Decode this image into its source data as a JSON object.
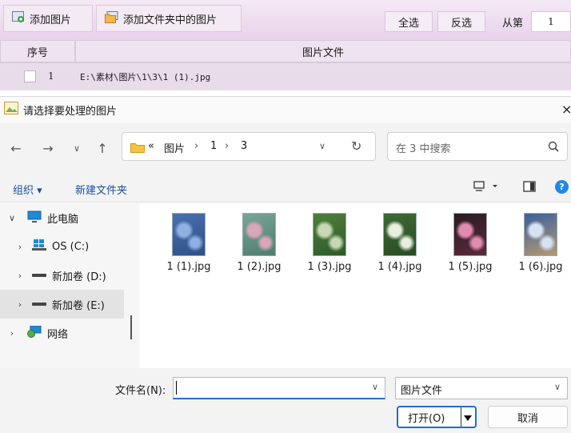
{
  "app": {
    "toolbar": {
      "add_image": "添加图片",
      "add_folder_images": "添加文件夹中的图片",
      "select_all": "全选",
      "invert_select": "反选",
      "from_label": "从第",
      "from_value": "1"
    },
    "grid": {
      "col_index": "序号",
      "col_file": "图片文件",
      "rows": [
        {
          "index": "1",
          "path": "E:\\素材\\图片\\1\\3\\1 (1).jpg"
        }
      ]
    }
  },
  "dialog": {
    "title": "请选择要处理的图片",
    "close": "×",
    "breadcrumb": {
      "overflow": "«",
      "items": [
        "图片",
        "1",
        "3"
      ],
      "sep": "›"
    },
    "search_placeholder": "在 3 中搜索",
    "commands": {
      "organize": "组织 ▾",
      "new_folder": "新建文件夹"
    },
    "tree": [
      {
        "label": "此电脑",
        "expanded": true
      },
      {
        "label": "OS (C:)"
      },
      {
        "label": "新加卷 (D:)"
      },
      {
        "label": "新加卷 (E:)",
        "selected": true
      },
      {
        "label": "网络"
      }
    ],
    "files": [
      {
        "name": "1 (1).jpg",
        "colors": [
          "#4a6fb0",
          "#8fb1e0",
          "#2f4f88"
        ]
      },
      {
        "name": "1 (2).jpg",
        "colors": [
          "#7aa59a",
          "#d9a7b8",
          "#4d7d6e"
        ]
      },
      {
        "name": "1 (3).jpg",
        "colors": [
          "#4f7f3a",
          "#c8d8b5",
          "#2d5a2a"
        ]
      },
      {
        "name": "1 (4).jpg",
        "colors": [
          "#3e6a34",
          "#e8efe0",
          "#284b24"
        ]
      },
      {
        "name": "1 (5).jpg",
        "colors": [
          "#2a1b22",
          "#e28bb0",
          "#5a2a3a"
        ]
      },
      {
        "name": "1 (6).jpg",
        "colors": [
          "#3b5f9e",
          "#d7e3f5",
          "#b49a70"
        ]
      }
    ],
    "filename_label": "文件名(N):",
    "filename_value": "",
    "filetype": "图片文件",
    "open_button": "打开(O)",
    "cancel_button": "取消"
  }
}
